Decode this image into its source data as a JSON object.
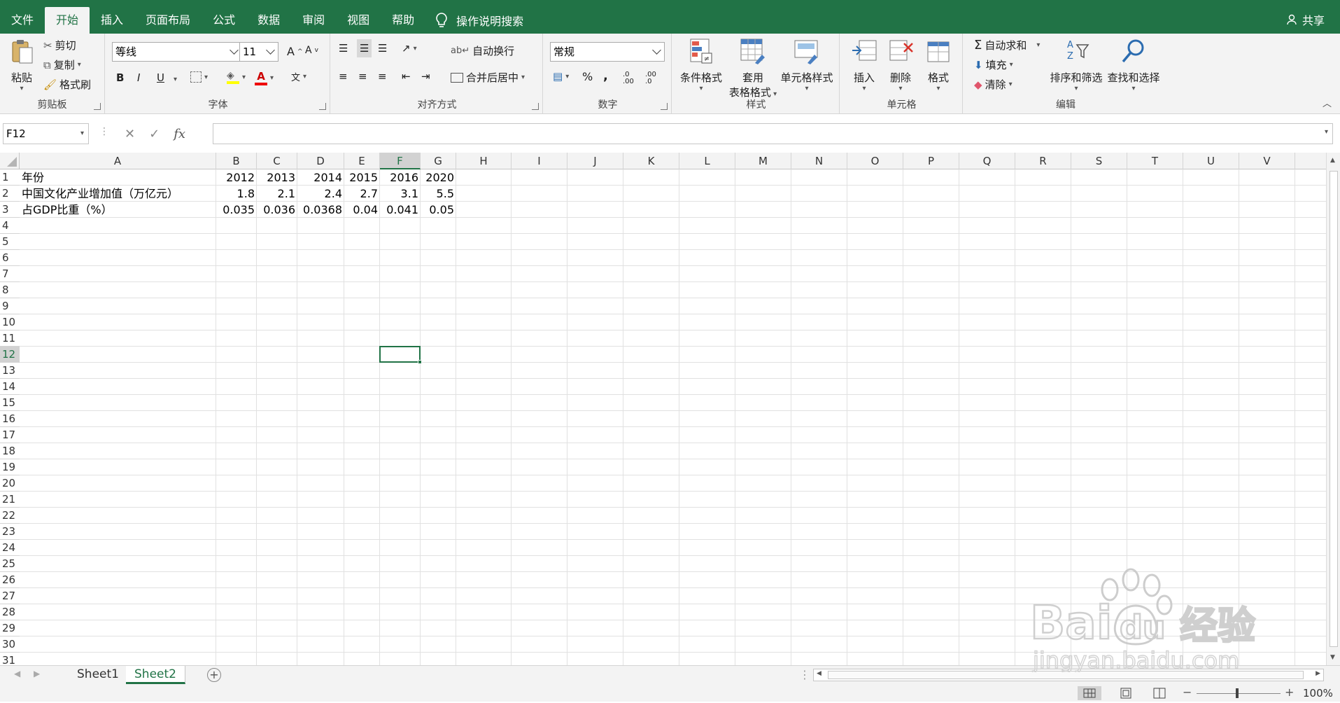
{
  "tabs": [
    "文件",
    "开始",
    "插入",
    "页面布局",
    "公式",
    "数据",
    "审阅",
    "视图",
    "帮助"
  ],
  "active_tab": "开始",
  "tell_me": "操作说明搜索",
  "share": "共享",
  "clipboard": {
    "paste": "粘贴",
    "cut": "剪切",
    "copy": "复制",
    "format_painter": "格式刷",
    "label": "剪贴板"
  },
  "font": {
    "name": "等线",
    "size": "11",
    "label": "字体",
    "bold": "B",
    "italic": "I",
    "underline": "U",
    "grow": "A",
    "shrink": "A",
    "font_color_letter": "A",
    "phonetic": "文"
  },
  "alignment": {
    "wrap": "自动换行",
    "merge": "合并后居中",
    "label": "对齐方式"
  },
  "number": {
    "format": "常规",
    "percent": "%",
    "comma": ",",
    "inc": ".0 .00",
    "dec": ".00 .0",
    "label": "数字"
  },
  "styles": {
    "conditional": "条件格式",
    "table1": "套用",
    "table2": "表格格式",
    "cell_styles": "单元格样式",
    "label": "样式"
  },
  "cells_group": {
    "insert": "插入",
    "delete": "删除",
    "format": "格式",
    "label": "单元格"
  },
  "editing": {
    "autosum": "自动求和",
    "fill": "填充",
    "clear": "清除",
    "sort": "排序和筛选",
    "find": "查找和选择",
    "label": "编辑"
  },
  "namebox": "F12",
  "fx": "fx",
  "columns": [
    "A",
    "B",
    "C",
    "D",
    "E",
    "F",
    "G",
    "H",
    "I",
    "J",
    "K",
    "L",
    "M",
    "N",
    "O",
    "P",
    "Q",
    "R",
    "S",
    "T",
    "U",
    "V"
  ],
  "selected_column": "F",
  "selected_row": "12",
  "rows": [
    "1",
    "2",
    "3",
    "4",
    "5",
    "6",
    "7",
    "8",
    "9",
    "10",
    "11",
    "12",
    "13",
    "14",
    "15",
    "16",
    "17",
    "18",
    "19",
    "20",
    "21",
    "22",
    "23",
    "24",
    "25",
    "26",
    "27",
    "28",
    "29",
    "30",
    "31"
  ],
  "data": [
    [
      "年份",
      "2012",
      "2013",
      "2014",
      "2015",
      "2016",
      "2020"
    ],
    [
      "中国文化产业增加值（万亿元）",
      "1.8",
      "2.1",
      "2.4",
      "2.7",
      "3.1",
      "5.5"
    ],
    [
      "占GDP比重（%）",
      "0.035",
      "0.036",
      "0.0368",
      "0.04",
      "0.041",
      "0.05"
    ]
  ],
  "sheets": [
    "Sheet1",
    "Sheet2"
  ],
  "active_sheet": "Sheet2",
  "zoom": "100%",
  "watermark": {
    "brand": "Bai",
    "brand2": "du",
    "cn": "经验",
    "url": "jingyan.baidu.com"
  },
  "colors": {
    "excel_green": "#217346",
    "ribbon_bg": "#f3f3f3"
  }
}
